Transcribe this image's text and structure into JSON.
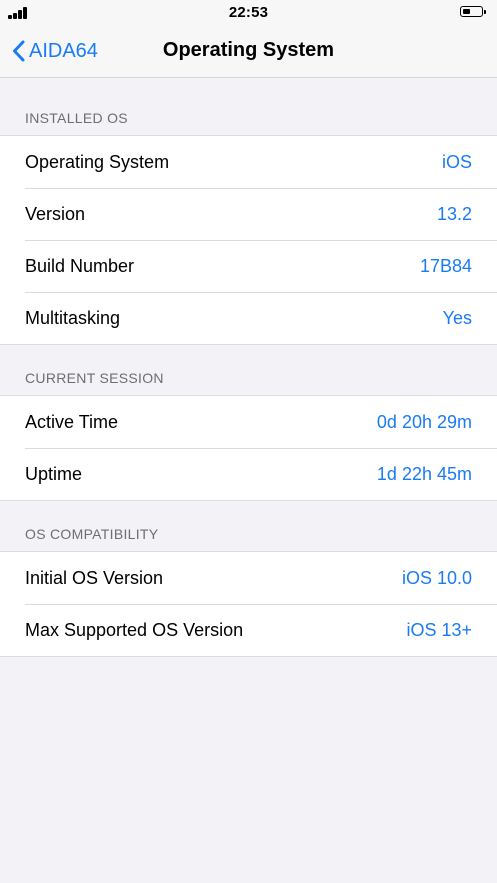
{
  "status_bar": {
    "time": "22:53"
  },
  "nav": {
    "back_label": "AIDA64",
    "title": "Operating System"
  },
  "sections": [
    {
      "header": "INSTALLED OS",
      "rows": [
        {
          "label": "Operating System",
          "value": "iOS"
        },
        {
          "label": "Version",
          "value": "13.2"
        },
        {
          "label": "Build Number",
          "value": "17B84"
        },
        {
          "label": "Multitasking",
          "value": "Yes"
        }
      ]
    },
    {
      "header": "CURRENT SESSION",
      "rows": [
        {
          "label": "Active Time",
          "value": "0d 20h 29m"
        },
        {
          "label": "Uptime",
          "value": "1d 22h 45m"
        }
      ]
    },
    {
      "header": "OS COMPATIBILITY",
      "rows": [
        {
          "label": "Initial OS Version",
          "value": "iOS 10.0"
        },
        {
          "label": "Max Supported OS Version",
          "value": "iOS 13+"
        }
      ]
    }
  ],
  "colors": {
    "accent": "#1a7cf5",
    "background": "#f2f2f7",
    "section_header_text": "#6d6d72"
  },
  "icons": {
    "signal": "cellular-signal-icon",
    "battery": "battery-icon",
    "back": "chevron-left-icon"
  }
}
